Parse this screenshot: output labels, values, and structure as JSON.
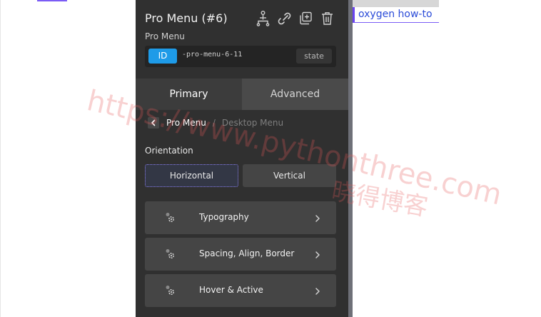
{
  "panel": {
    "title": "Pro Menu (#6)",
    "subtitle": "Pro Menu",
    "icons": [
      "structure-icon",
      "link-icon",
      "duplicate-icon",
      "delete-icon"
    ],
    "id_badge": "ID",
    "id_value": "-pro-menu-6-11",
    "state_label": "state",
    "tabs": [
      {
        "label": "Primary",
        "active": true
      },
      {
        "label": "Advanced",
        "active": false
      }
    ],
    "breadcrumb": {
      "current": "Pro Menu",
      "separator": "/",
      "parent": "Desktop Menu"
    },
    "orientation": {
      "label": "Orientation",
      "options": [
        "Horizontal",
        "Vertical"
      ],
      "selected": "Horizontal"
    },
    "sections": [
      {
        "label": "Typography"
      },
      {
        "label": "Spacing, Align, Border"
      },
      {
        "label": "Hover & Active"
      }
    ]
  },
  "canvas": {
    "link_text": "oxygen how-to"
  },
  "watermark": {
    "line1": "https://www.pythonthree.com",
    "line2": "晓得博客"
  },
  "colors": {
    "panel_bg": "#303030",
    "accent_blue": "#1e9be8",
    "selected_outline": "#8a7ff0",
    "link": "#2a4bd8",
    "canvas_marker": "#6a44f0"
  }
}
